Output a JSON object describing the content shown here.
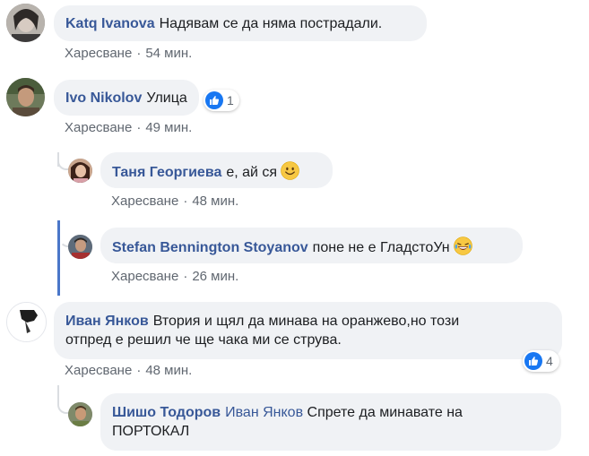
{
  "comments": [
    {
      "author": "Katq Ivanova",
      "text": "Надявам се да няма пострадали.",
      "like_label": "Харесване",
      "time": "54 мин."
    },
    {
      "author": "Ivo Nikolov",
      "text": "Улица",
      "like_label": "Харесване",
      "time": "49 мин.",
      "reactions": "1"
    },
    {
      "author": "Таня Георгиева",
      "text": "е, ай ся",
      "like_label": "Харесване",
      "time": "48 мин."
    },
    {
      "author": "Stefan Bennington Stoyanov",
      "text": "поне не е ГладстоУн",
      "like_label": "Харесване",
      "time": "26 мин."
    },
    {
      "author": "Иван Янков",
      "text_line1": "Втория и щял да минава на оранжево,но този",
      "text_line2": "отпред е решил че ще чака ми се струва.",
      "like_label": "Харесване",
      "time": "48 мин.",
      "reactions": "4"
    },
    {
      "author": "Шишо Тодоров",
      "mention": "Иван Янков",
      "text_line1": "Спрете да минавате на",
      "text_line2": "ПОРТОКАЛ"
    }
  ],
  "meta_separator": "·",
  "colors": {
    "author_link": "#385898",
    "bubble_bg": "#f0f2f5",
    "meta_text": "#606770",
    "like_blue": "#1877f2",
    "thread_highlight": "#4a76c9"
  }
}
